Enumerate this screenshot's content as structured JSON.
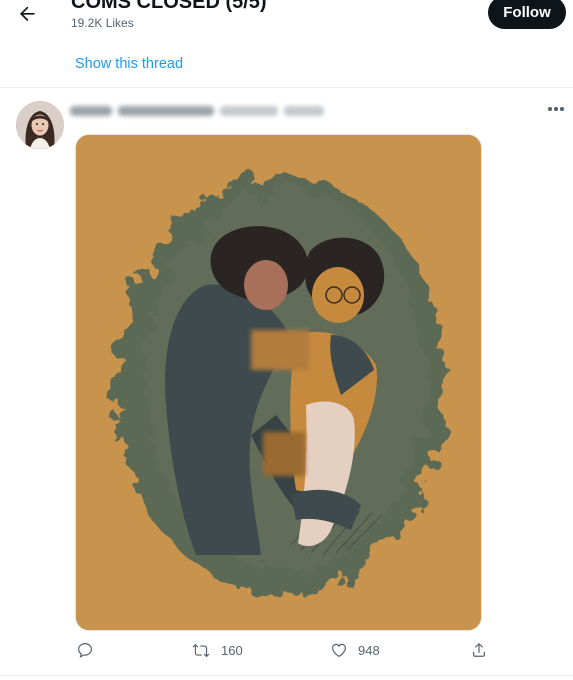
{
  "header": {
    "title": "COMS CLOSED (5/5)",
    "likes": "19.2K Likes",
    "follow_label": "Follow"
  },
  "thread": {
    "show_thread_label": "Show this thread"
  },
  "tweet": {
    "retweet_count": "160",
    "like_count": "948"
  },
  "icons": {
    "back": "arrow-left-icon",
    "more": "more-horizontal-icon",
    "reply": "reply-icon",
    "retweet": "retweet-icon",
    "like": "heart-icon",
    "share": "share-icon"
  },
  "colors": {
    "accent": "#1d9bf0",
    "follow_bg": "#0f1419",
    "muted": "#536471",
    "media_bg": "#c8944d",
    "media_vignette": "#5c6a55"
  }
}
